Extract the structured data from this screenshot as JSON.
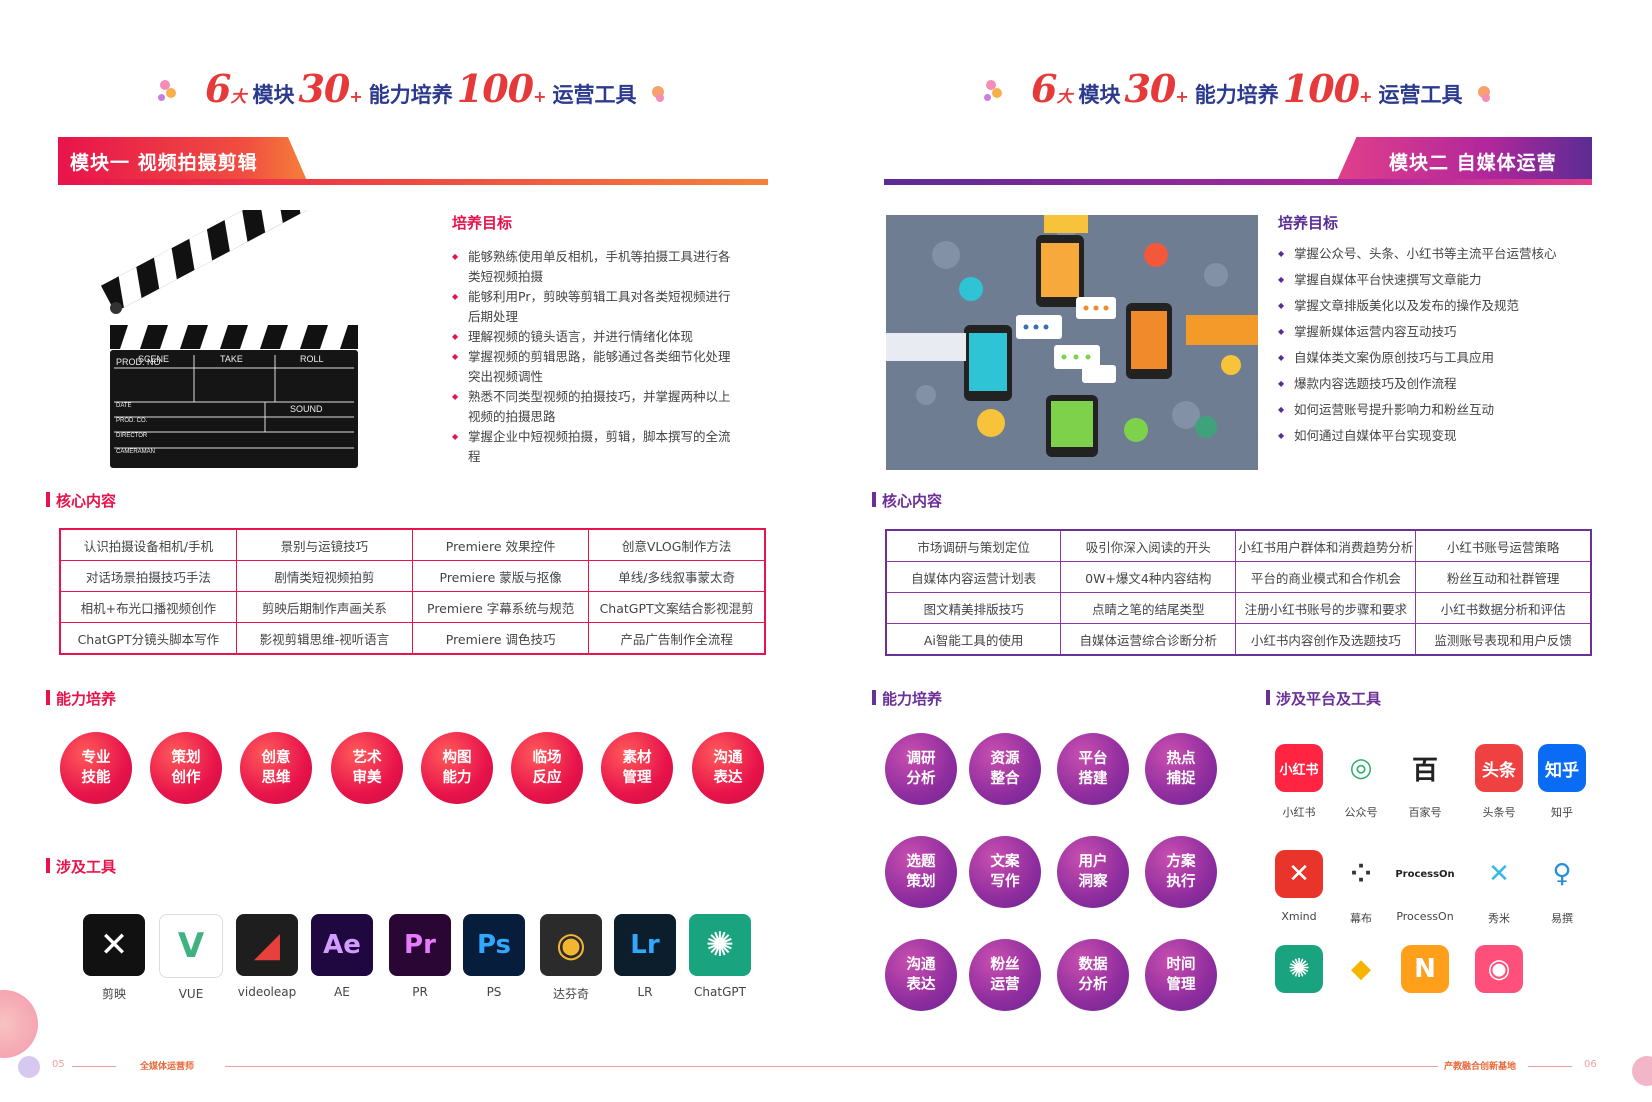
{
  "banner": {
    "n1": "6",
    "s1": "大",
    "t1": "模块",
    "n2": "30",
    "s2": "+",
    "t2": "能力培养",
    "n3": "100",
    "s3": "+",
    "t3": "运营工具"
  },
  "left": {
    "module_title": "模块一  视频拍摄剪辑",
    "goal_heading": "培养目标",
    "goals": [
      "能够熟练使用单反相机，手机等拍摄工具进行各类短视频拍摄",
      "能够利用Pr，剪映等剪辑工具对各类短视频进行后期处理",
      "理解视频的镜头语言，并进行情绪化体现",
      "掌握视频的剪辑思路，能够通过各类细节化处理突出视频调性",
      "熟悉不同类型视频的拍摄技巧，并掌握两种以上视频的拍摄思路",
      "掌握企业中短视频拍摄，剪辑，脚本撰写的全流程"
    ],
    "clapper": {
      "prod": "PROD. NO",
      "scene": "SCENE",
      "take": "TAKE",
      "roll": "ROLL",
      "date": "DATE",
      "sound": "SOUND",
      "prodco": "PROD. CO.",
      "director": "DIRECTOR",
      "cameraman": "CAMERAMAN"
    },
    "core_heading": "核心内容",
    "core_table": [
      [
        "认识拍摄设备相机/手机",
        "景别与运镜技巧",
        "Premiere 效果控件",
        "创意VLOG制作方法"
      ],
      [
        "对话场景拍摄技巧手法",
        "剧情类短视频拍剪",
        "Premiere 蒙版与抠像",
        "单线/多线叙事蒙太奇"
      ],
      [
        "相机+布光口播视频创作",
        "剪映后期制作声画关系",
        "Premiere 字幕系统与规范",
        "ChatGPT文案结合影视混剪"
      ],
      [
        "ChatGPT分镜头脚本写作",
        "影视剪辑思维-视听语言",
        "Premiere 调色技巧",
        "产品广告制作全流程"
      ]
    ],
    "ability_heading": "能力培养",
    "abilities": [
      [
        "专业",
        "技能"
      ],
      [
        "策划",
        "创作"
      ],
      [
        "创意",
        "思维"
      ],
      [
        "艺术",
        "审美"
      ],
      [
        "构图",
        "能力"
      ],
      [
        "临场",
        "反应"
      ],
      [
        "素材",
        "管理"
      ],
      [
        "沟通",
        "表达"
      ]
    ],
    "tools_heading": "涉及工具",
    "tools": [
      {
        "label": "剪映",
        "glyph": "✕",
        "bg": "#111111",
        "fg": "#ffffff"
      },
      {
        "label": "VUE",
        "glyph": "V",
        "bg": "#ffffff",
        "fg": "#3fb27f"
      },
      {
        "label": "videoleap",
        "glyph": "◢",
        "bg": "#1e1e1e",
        "fg": "#e8403a"
      },
      {
        "label": "AE",
        "glyph": "Ae",
        "bg": "#1f0740",
        "fg": "#d49cff"
      },
      {
        "label": "PR",
        "glyph": "Pr",
        "bg": "#2a0634",
        "fg": "#e77cff"
      },
      {
        "label": "PS",
        "glyph": "Ps",
        "bg": "#061e3c",
        "fg": "#31a8ff"
      },
      {
        "label": "达芬奇",
        "glyph": "◉",
        "bg": "#2b2b2b",
        "fg": "#f2b632"
      },
      {
        "label": "LR",
        "glyph": "Lr",
        "bg": "#0c1d2b",
        "fg": "#31a8ff"
      },
      {
        "label": "ChatGPT",
        "glyph": "✺",
        "bg": "#19a37e",
        "fg": "#ffffff"
      }
    ],
    "footer_num": "05",
    "footer_text": "全媒体运营师"
  },
  "right": {
    "module_title": "模块二  自媒体运营",
    "goal_heading": "培养目标",
    "goals": [
      "掌握公众号、头条、小红书等主流平台运营核心",
      "掌握自媒体平台快速撰写文章能力",
      "掌握文章排版美化以及发布的操作及规范",
      "掌握新媒体运营内容互动技巧",
      "自媒体类文案伪原创技巧与工具应用",
      "爆款内容选题技巧及创作流程",
      "如何运营账号提升影响力和粉丝互动",
      "如何通过自媒体平台实现变现"
    ],
    "core_heading": "核心内容",
    "core_table": [
      [
        "市场调研与策划定位",
        "吸引你深入阅读的开头",
        "小红书用户群体和消费趋势分析",
        "小红书账号运营策略"
      ],
      [
        "自媒体内容运营计划表",
        "0W+爆文4种内容结构",
        "平台的商业模式和合作机会",
        "粉丝互动和社群管理"
      ],
      [
        "图文精美排版技巧",
        "点睛之笔的结尾类型",
        "注册小红书账号的步骤和要求",
        "小红书数据分析和评估"
      ],
      [
        "Ai智能工具的使用",
        "自媒体运营综合诊断分析",
        "小红书内容创作及选题技巧",
        "监测账号表现和用户反馈"
      ]
    ],
    "ability_heading": "能力培养",
    "abilities": [
      [
        "调研",
        "分析"
      ],
      [
        "资源",
        "整合"
      ],
      [
        "平台",
        "搭建"
      ],
      [
        "热点",
        "捕捉"
      ],
      [
        "选题",
        "策划"
      ],
      [
        "文案",
        "写作"
      ],
      [
        "用户",
        "洞察"
      ],
      [
        "方案",
        "执行"
      ],
      [
        "沟通",
        "表达"
      ],
      [
        "粉丝",
        "运营"
      ],
      [
        "数据",
        "分析"
      ],
      [
        "时间",
        "管理"
      ]
    ],
    "platforms_heading": "涉及平台及工具",
    "platforms": [
      {
        "label": "小红书",
        "glyph": "小红书",
        "bg": "#ff2442",
        "fg": "#ffffff"
      },
      {
        "label": "公众号",
        "glyph": "◎",
        "bg": "#ffffff",
        "fg": "#2aae67"
      },
      {
        "label": "百家号",
        "glyph": "百",
        "bg": "#ffffff",
        "fg": "#222222"
      },
      {
        "label": "头条号",
        "glyph": "头条",
        "bg": "#f04142",
        "fg": "#ffffff"
      },
      {
        "label": "知乎",
        "glyph": "知乎",
        "bg": "#0a6cf5",
        "fg": "#ffffff"
      },
      {
        "label": "Xmind",
        "glyph": "✕",
        "bg": "#e8342b",
        "fg": "#ffffff"
      },
      {
        "label": "幕布",
        "glyph": "⁘",
        "bg": "#ffffff",
        "fg": "#333333"
      },
      {
        "label": "ProcessOn",
        "glyph": "ProcessOn",
        "bg": "#ffffff",
        "fg": "#222222"
      },
      {
        "label": "秀米",
        "glyph": "✕",
        "bg": "#ffffff",
        "fg": "#37b8e6"
      },
      {
        "label": "易撰",
        "glyph": "♀",
        "bg": "#ffffff",
        "fg": "#2a8fd6"
      },
      {
        "label": "",
        "glyph": "✺",
        "bg": "#1aa37f",
        "fg": "#ffffff"
      },
      {
        "label": "",
        "glyph": "◆",
        "bg": "#ffffff",
        "fg": "#f5b400"
      },
      {
        "label": "",
        "glyph": "N",
        "bg": "#ff9f1a",
        "fg": "#ffffff"
      },
      {
        "label": "",
        "glyph": "◉",
        "bg": "#ff4f7b",
        "fg": "#ffffff"
      }
    ],
    "footer_num": "06",
    "footer_text": "产教融合创新基地"
  }
}
